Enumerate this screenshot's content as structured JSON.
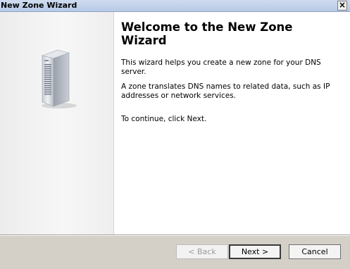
{
  "window": {
    "title": "New Zone Wizard",
    "close_glyph": "×"
  },
  "content": {
    "heading": "Welcome to the New Zone\nWizard",
    "para1": "This wizard helps you create a new zone for your DNS server.",
    "para2": "A zone translates DNS names to related data, such as IP addresses or network services.",
    "para3": "To continue, click Next."
  },
  "buttons": {
    "back": "< Back",
    "next": "Next >",
    "cancel": "Cancel"
  },
  "icons": {
    "server": "server-icon"
  }
}
